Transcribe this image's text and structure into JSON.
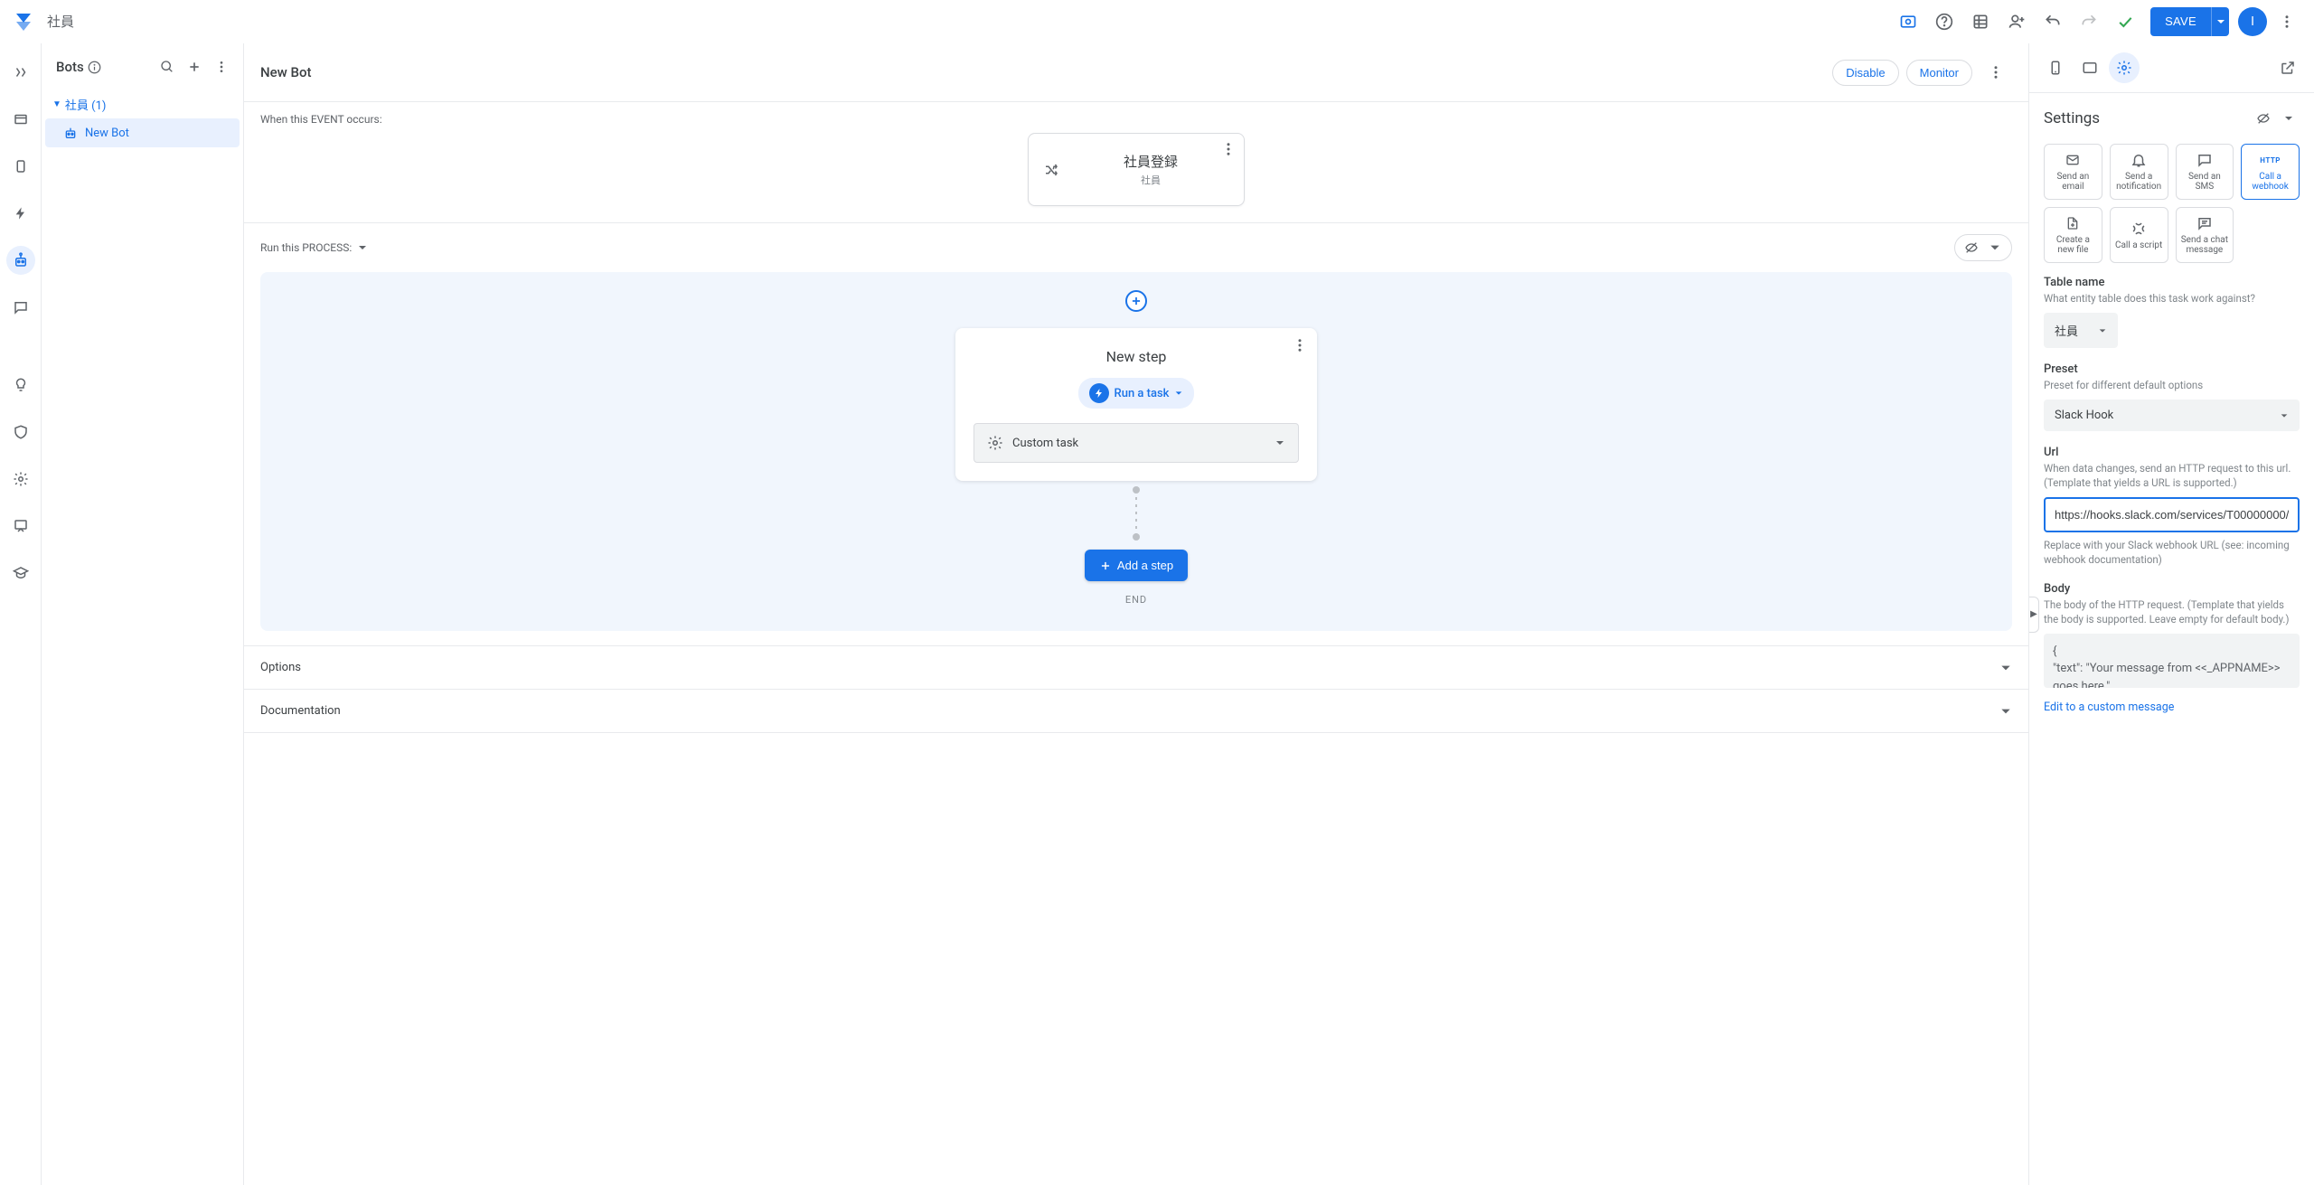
{
  "header": {
    "app_title": "社員",
    "save_label": "SAVE",
    "avatar_initial": "I"
  },
  "bots_panel": {
    "title": "Bots",
    "folder_label": "社員 (1)",
    "items": [
      {
        "label": "New Bot"
      }
    ]
  },
  "canvas": {
    "title": "New Bot",
    "disable_label": "Disable",
    "monitor_label": "Monitor",
    "event_section_label": "When this EVENT occurs:",
    "event": {
      "title": "社員登録",
      "subtitle": "社員"
    },
    "process_section_label": "Run this PROCESS:",
    "step": {
      "title": "New step",
      "run_task_label": "Run a task",
      "task_selected": "Custom task"
    },
    "add_step_label": "Add a step",
    "end_label": "END",
    "accordion": {
      "options": "Options",
      "documentation": "Documentation"
    }
  },
  "settings": {
    "title": "Settings",
    "tiles": [
      {
        "label": "Send an email"
      },
      {
        "label": "Send a notification"
      },
      {
        "label": "Send an SMS"
      },
      {
        "label": "Call a webhook"
      },
      {
        "label": "Create a new file"
      },
      {
        "label": "Call a script"
      },
      {
        "label": "Send a chat message"
      }
    ],
    "http_badge": "HTTP",
    "table_name": {
      "label": "Table name",
      "help": "What entity table does this task work against?",
      "value": "社員"
    },
    "preset": {
      "label": "Preset",
      "help": "Preset for different default options",
      "value": "Slack Hook"
    },
    "url": {
      "label": "Url",
      "help": "When data changes, send an HTTP request to this url. (Template that yields a URL is supported.)",
      "value": "https://hooks.slack.com/services/T00000000/",
      "help_below": "Replace with your Slack webhook URL (see: incoming webhook documentation)"
    },
    "body": {
      "label": "Body",
      "help": "The body of the HTTP request. (Template that yields the body is supported. Leave empty for default body.)",
      "value": "{\n\"text\": \"Your message from <<_APPNAME>> goes here.\""
    },
    "edit_link": "Edit to a custom message"
  }
}
